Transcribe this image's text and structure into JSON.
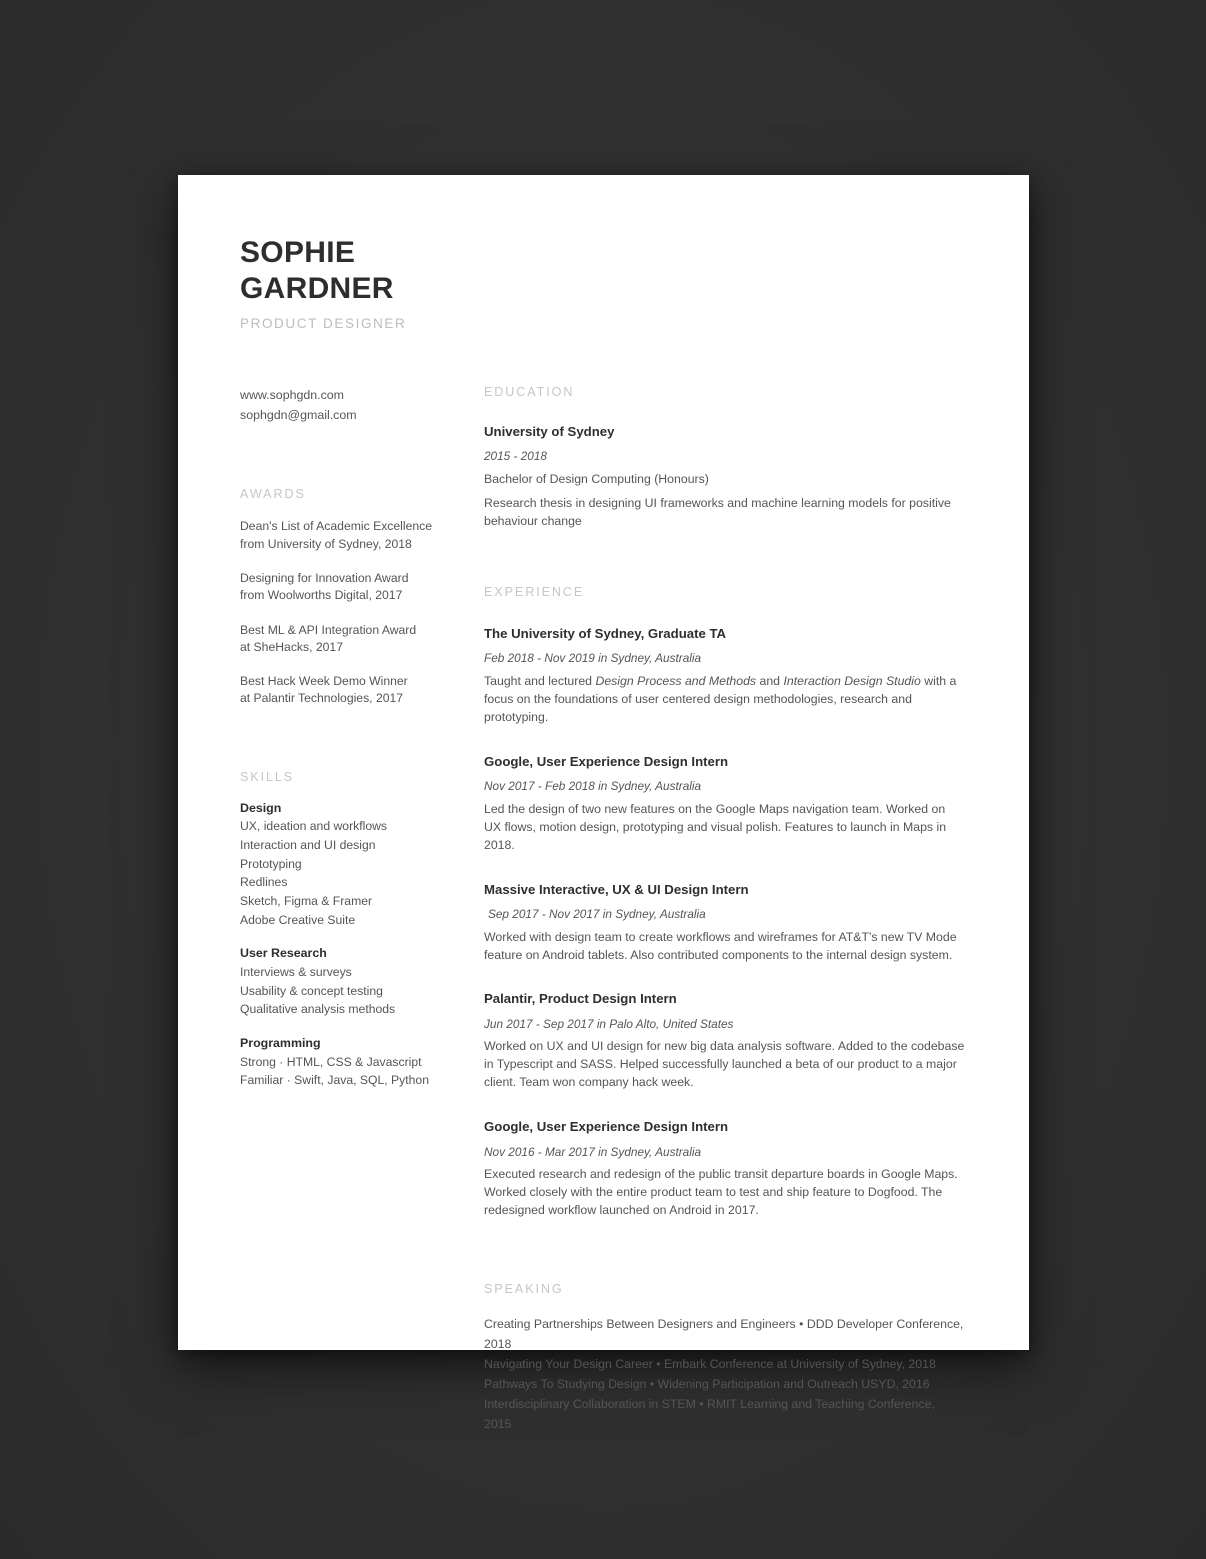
{
  "header": {
    "first_name": "SOPHIE",
    "last_name": "GARDNER",
    "role": "PRODUCT DESIGNER"
  },
  "contact": {
    "website": "www.sophgdn.com",
    "email": "sophgdn@gmail.com"
  },
  "awards": {
    "title": "AWARDS",
    "items": [
      {
        "line1": "Dean's List of Academic Excellence",
        "line2": "from University of Sydney, 2018"
      },
      {
        "line1": "Designing for Innovation Award",
        "line2": "from Woolworths Digital, 2017"
      },
      {
        "line1": "Best ML & API Integration Award",
        "line2": "at SheHacks, 2017"
      },
      {
        "line1": "Best Hack Week Demo Winner",
        "line2": "at Palantir Technologies, 2017"
      }
    ]
  },
  "skills": {
    "title": "SKILLS",
    "groups": [
      {
        "name": "Design",
        "items": [
          "UX, ideation and workflows",
          "Interaction and UI design",
          "Prototyping",
          "Redlines",
          "Sketch, Figma & Framer",
          "Adobe Creative Suite"
        ]
      },
      {
        "name": "User Research",
        "items": [
          "Interviews & surveys",
          "Usability & concept testing",
          "Qualitative analysis methods"
        ]
      },
      {
        "name": "Programming",
        "items": [
          "Strong · HTML, CSS & Javascript",
          "Familiar · Swift, Java, SQL, Python"
        ]
      }
    ]
  },
  "education": {
    "title": "EDUCATION",
    "school": "University of Sydney",
    "dates": "2015 - 2018",
    "degree": "Bachelor of Design Computing (Honours)",
    "thesis": "Research thesis in designing UI frameworks and machine learning models for positive behaviour change"
  },
  "experience": {
    "title": "EXPERIENCE",
    "entries": [
      {
        "role": "The University of Sydney, Graduate TA",
        "meta": "Feb 2018 - Nov 2019 in Sydney, Australia",
        "body_pre": "Taught and lectured ",
        "body_em1": "Design Process and Methods",
        "body_mid": " and ",
        "body_em2": "Interaction Design Studio",
        "body_post": " with a focus on the foundations of user centered design methodologies, research and prototyping."
      },
      {
        "role": "Google, User Experience Design Intern",
        "meta": "Nov 2017 - Feb 2018 in Sydney, Australia",
        "body": "Led the design of two new features on the Google Maps navigation team. Worked on UX flows, motion design, prototyping and visual polish. Features to launch in Maps in 2018."
      },
      {
        "role": "Massive Interactive, UX & UI Design Intern",
        "meta": "Sep 2017 - Nov 2017 in Sydney, Australia",
        "body": "Worked with design team to create workflows and wireframes for AT&T's new TV Mode feature on Android tablets. Also contributed components to the internal design system."
      },
      {
        "role": "Palantir, Product Design Intern",
        "meta": "Jun 2017 - Sep 2017 in Palo Alto, United States",
        "body": "Worked on UX and UI design for new big data analysis software. Added to the codebase in Typescript and SASS. Helped successfully launched a beta of our product to a major client. Team won company hack week."
      },
      {
        "role": "Google, User Experience Design Intern",
        "meta": "Nov 2016 - Mar 2017 in Sydney, Australia",
        "body": "Executed research and redesign of the public transit departure boards in Google Maps. Worked closely with the entire product team to test and ship feature to Dogfood. The redesigned workflow launched on Android in 2017."
      }
    ]
  },
  "speaking": {
    "title": "SPEAKING",
    "items": [
      "Creating Partnerships Between Designers and Engineers • DDD Developer Conference, 2018",
      "Navigating Your Design Career • Embark Conference at University of Sydney, 2018",
      "Pathways To Studying Design • Widening Participation and Outreach USYD, 2016",
      "Interdisciplinary Collaboration in STEM • RMIT Learning and Teaching Conference, 2015"
    ]
  }
}
